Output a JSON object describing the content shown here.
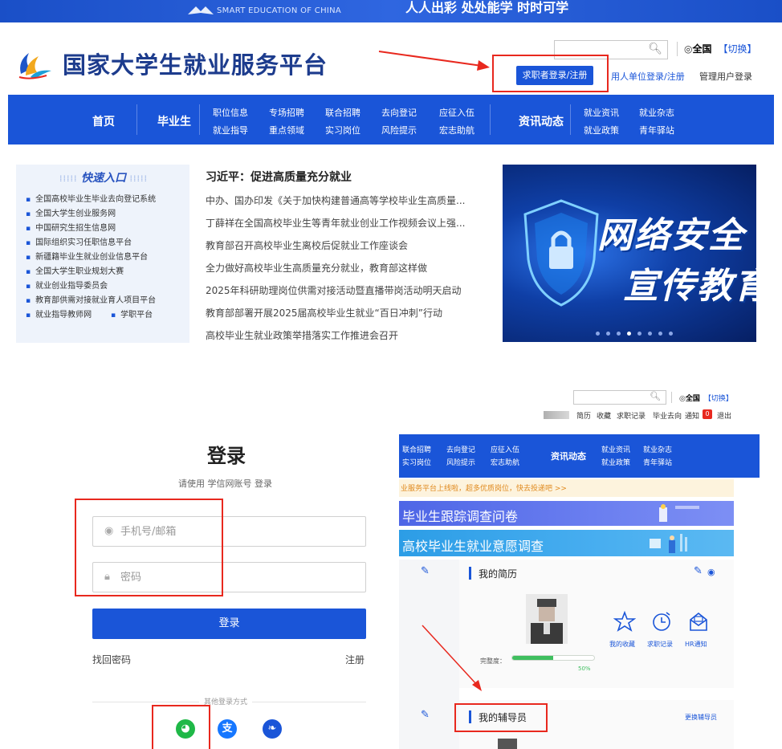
{
  "topbar": {
    "brand_en": "SMART EDUCATION OF CHINA",
    "slogan": "人人出彩 处处能学 时时可学"
  },
  "header": {
    "site_title": "国家大学生就业服务平台",
    "location_label": "全国",
    "location_switch": "【切换】",
    "jobseeker_login": "求职者登录/注册",
    "employer_login": "用人单位登录/注册",
    "admin_login": "管理用户登录"
  },
  "nav": {
    "home": "首页",
    "graduates": "毕业生",
    "cols": [
      {
        "top": "职位信息",
        "bottom": "就业指导"
      },
      {
        "top": "专场招聘",
        "bottom": "重点领域"
      },
      {
        "top": "联合招聘",
        "bottom": "实习岗位"
      },
      {
        "top": "去向登记",
        "bottom": "风险提示"
      },
      {
        "top": "应征入伍",
        "bottom": "宏志助航"
      }
    ],
    "news": "资讯动态",
    "news_cols": [
      {
        "top": "就业资讯",
        "bottom": "就业政策"
      },
      {
        "top": "就业杂志",
        "bottom": "青年驿站"
      }
    ]
  },
  "quick_entry": {
    "title": "快速入口",
    "items": [
      "全国高校毕业生毕业去向登记系统",
      "全国大学生创业服务网",
      "中国研究生招生信息网",
      "国际组织实习任职信息平台",
      "新疆籍毕业生就业创业信息平台",
      "全国大学生职业规划大赛",
      "就业创业指导委员会",
      "教育部供需对接就业育人项目平台"
    ],
    "last_row": [
      "就业指导教师网",
      "学职平台"
    ]
  },
  "news": {
    "headline": "习近平：促进高质量充分就业",
    "items": [
      "中办、国办印发《关于加快构建普通高等学校毕业生高质量...",
      "丁薛祥在全国高校毕业生等青年就业创业工作视频会议上强...",
      "教育部召开高校毕业生离校后促就业工作座谈会",
      "全力做好高校毕业生高质量充分就业，教育部这样做",
      "2025年科研助理岗位供需对接活动暨直播带岗活动明天启动",
      "教育部部署开展2025届高校毕业生就业“百日冲刺”行动",
      "高校毕业生就业政策举措落实工作推进会召开"
    ]
  },
  "banner": {
    "line1": "网络安全",
    "line2": "宣传教育"
  },
  "login": {
    "title": "登录",
    "hint": "请使用 学信网账号 登录",
    "phone_placeholder": "手机号/邮箱",
    "password_placeholder": "密码",
    "submit": "登录",
    "forgot": "找回密码",
    "register": "注册",
    "other_methods": "其他登录方式",
    "social": [
      {
        "name": "wechat-icon",
        "glyph": "◕",
        "color": "#1fb847"
      },
      {
        "name": "alipay-icon",
        "glyph": "支",
        "color": "#1677ff"
      },
      {
        "name": "chsi-icon",
        "glyph": "❧",
        "color": "#1a55d8"
      }
    ]
  },
  "user_center": {
    "location_label": "全国",
    "location_switch": "【切换】",
    "top_links": [
      "简历",
      "收藏",
      "求职记录",
      "毕业去向",
      "通知"
    ],
    "notify_count": "0",
    "logout": "退出",
    "nav_cols": [
      {
        "top": "联合招聘",
        "bottom": "实习岗位"
      },
      {
        "top": "去向登记",
        "bottom": "风险提示"
      },
      {
        "top": "应征入伍",
        "bottom": "宏志助航"
      }
    ],
    "nav_news": "资讯动态",
    "nav_news_cols": [
      {
        "top": "就业资讯",
        "bottom": "就业政策"
      },
      {
        "top": "就业杂志",
        "bottom": "青年驿站"
      }
    ],
    "notice": "业服务平台上线啦，超多优质岗位，快去投递吧 >>",
    "survey1": "毕业生跟踪调查问卷",
    "survey2": "高校毕业生就业意愿调查",
    "resume_title": "我的简历",
    "actions": [
      "我的收藏",
      "求职记录",
      "HR通知"
    ],
    "completeness_label": "完整度：",
    "completeness_pct": "50%",
    "completeness_value": 0.5,
    "tutor_title": "我的辅导员",
    "change_tutor": "更换辅导员"
  },
  "colors": {
    "primary": "#1a55d8",
    "title_blue": "#1d3c8d",
    "annotation_red": "#e8281e",
    "progress_green": "#3fbf5f"
  }
}
